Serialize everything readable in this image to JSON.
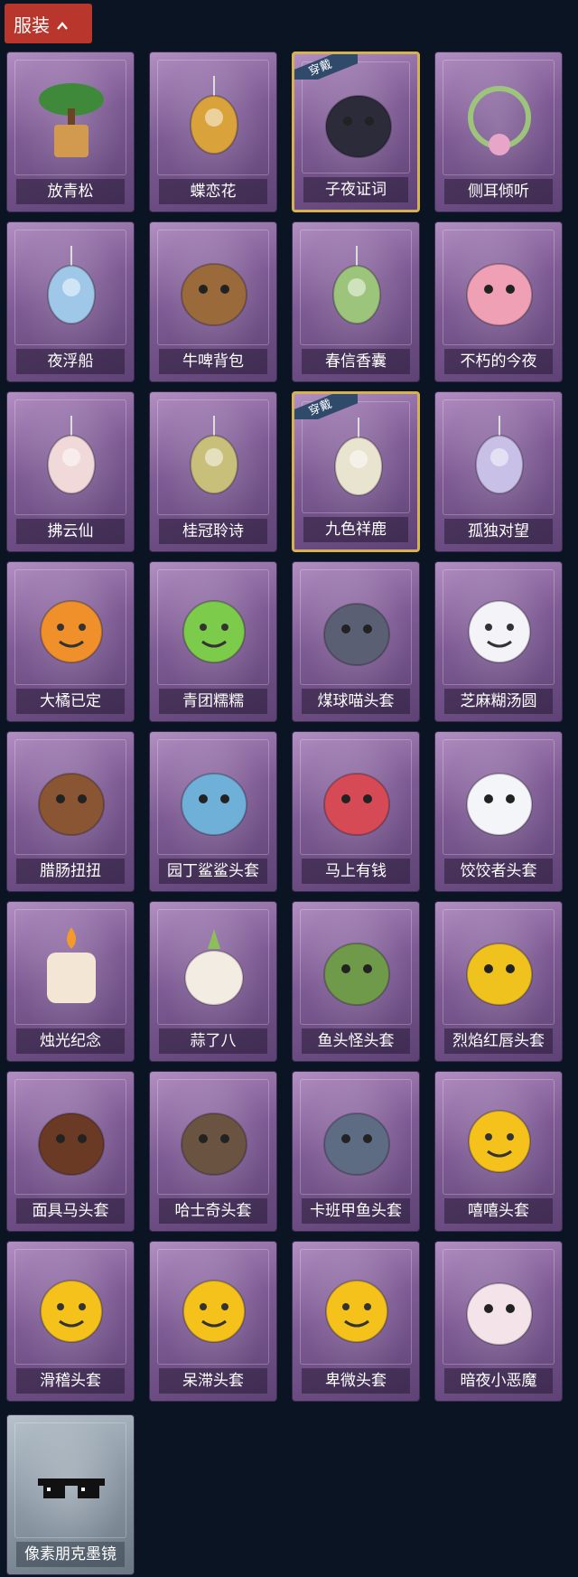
{
  "header": {
    "tab_label": "服装"
  },
  "ribbon_label": "穿戴",
  "items": [
    {
      "label": "放青松",
      "icon": "bonsai-tree-icon",
      "color": "#3f8a3a",
      "equipped": false
    },
    {
      "label": "蝶恋花",
      "icon": "bell-ornament-icon",
      "color": "#d9a23b",
      "equipped": false
    },
    {
      "label": "子夜证词",
      "icon": "crow-doll-icon",
      "color": "#2b2b3a",
      "equipped": true
    },
    {
      "label": "侧耳倾听",
      "icon": "flower-wreath-icon",
      "color": "#e7a6c8",
      "equipped": false
    },
    {
      "label": "夜浮船",
      "icon": "jellyfish-icon",
      "color": "#9fc8e8",
      "equipped": false
    },
    {
      "label": "牛啤背包",
      "icon": "cow-barrel-icon",
      "color": "#9a6a3b",
      "equipped": false
    },
    {
      "label": "春信香囊",
      "icon": "sachet-icon",
      "color": "#9cc47a",
      "equipped": false
    },
    {
      "label": "不朽的今夜",
      "icon": "pink-fox-icon",
      "color": "#f0a0b4",
      "equipped": false
    },
    {
      "label": "拂云仙",
      "icon": "fairy-charm-icon",
      "color": "#f1d9d9",
      "equipped": false
    },
    {
      "label": "桂冠聆诗",
      "icon": "laurel-doll-icon",
      "color": "#c8c07a",
      "equipped": false
    },
    {
      "label": "九色祥鹿",
      "icon": "deer-charm-icon",
      "color": "#e8e4d0",
      "equipped": true
    },
    {
      "label": "孤独对望",
      "icon": "doll-charm-icon",
      "color": "#c9c0e8",
      "equipped": false
    },
    {
      "label": "大橘已定",
      "icon": "orange-slice-icon",
      "color": "#f0902a",
      "equipped": false
    },
    {
      "label": "青团糯糯",
      "icon": "green-mochi-icon",
      "color": "#7ccb4a",
      "equipped": false
    },
    {
      "label": "煤球喵头套",
      "icon": "black-cat-icon",
      "color": "#5a5f73",
      "equipped": false
    },
    {
      "label": "芝麻糊汤圆",
      "icon": "rice-ball-icon",
      "color": "#f3f3f8",
      "equipped": false
    },
    {
      "label": "腊肠扭扭",
      "icon": "sausage-dog-icon",
      "color": "#8a5532",
      "equipped": false
    },
    {
      "label": "园丁鲨鲨头套",
      "icon": "shark-icon",
      "color": "#6fb0d8",
      "equipped": false
    },
    {
      "label": "马上有钱",
      "icon": "red-horse-icon",
      "color": "#d64a55",
      "equipped": false
    },
    {
      "label": "饺饺者头套",
      "icon": "dumpling-icon",
      "color": "#f3f5f8",
      "equipped": false
    },
    {
      "label": "烛光纪念",
      "icon": "candle-icon",
      "color": "#f4e6d4",
      "equipped": false
    },
    {
      "label": "蒜了八",
      "icon": "garlic-icon",
      "color": "#f2ece2",
      "equipped": false
    },
    {
      "label": "鱼头怪头套",
      "icon": "fish-head-icon",
      "color": "#6f9a4a",
      "equipped": false
    },
    {
      "label": "烈焰红唇头套",
      "icon": "yellow-mouse-icon",
      "color": "#f0c21e",
      "equipped": false
    },
    {
      "label": "面具马头套",
      "icon": "horse-mask-icon",
      "color": "#6b3a24",
      "equipped": false
    },
    {
      "label": "哈士奇头套",
      "icon": "husky-icon",
      "color": "#6a5441",
      "equipped": false
    },
    {
      "label": "卡班甲鱼头套",
      "icon": "whale-icon",
      "color": "#5d6b83",
      "equipped": false
    },
    {
      "label": "嘻嘻头套",
      "icon": "grin-emoji-icon",
      "color": "#f4c21a",
      "equipped": false
    },
    {
      "label": "滑稽头套",
      "icon": "funny-emoji-icon",
      "color": "#f4c21a",
      "equipped": false
    },
    {
      "label": "呆滞头套",
      "icon": "dazed-emoji-icon",
      "color": "#f4c21a",
      "equipped": false
    },
    {
      "label": "卑微头套",
      "icon": "humble-emoji-icon",
      "color": "#f4c21a",
      "equipped": false
    },
    {
      "label": "暗夜小恶魔",
      "icon": "little-devil-icon",
      "color": "#f4e4ea",
      "equipped": false
    },
    {
      "label": "像素朋克墨镜",
      "icon": "pixel-sunglasses-icon",
      "color": "#111111",
      "equipped": false,
      "grey": true
    }
  ]
}
